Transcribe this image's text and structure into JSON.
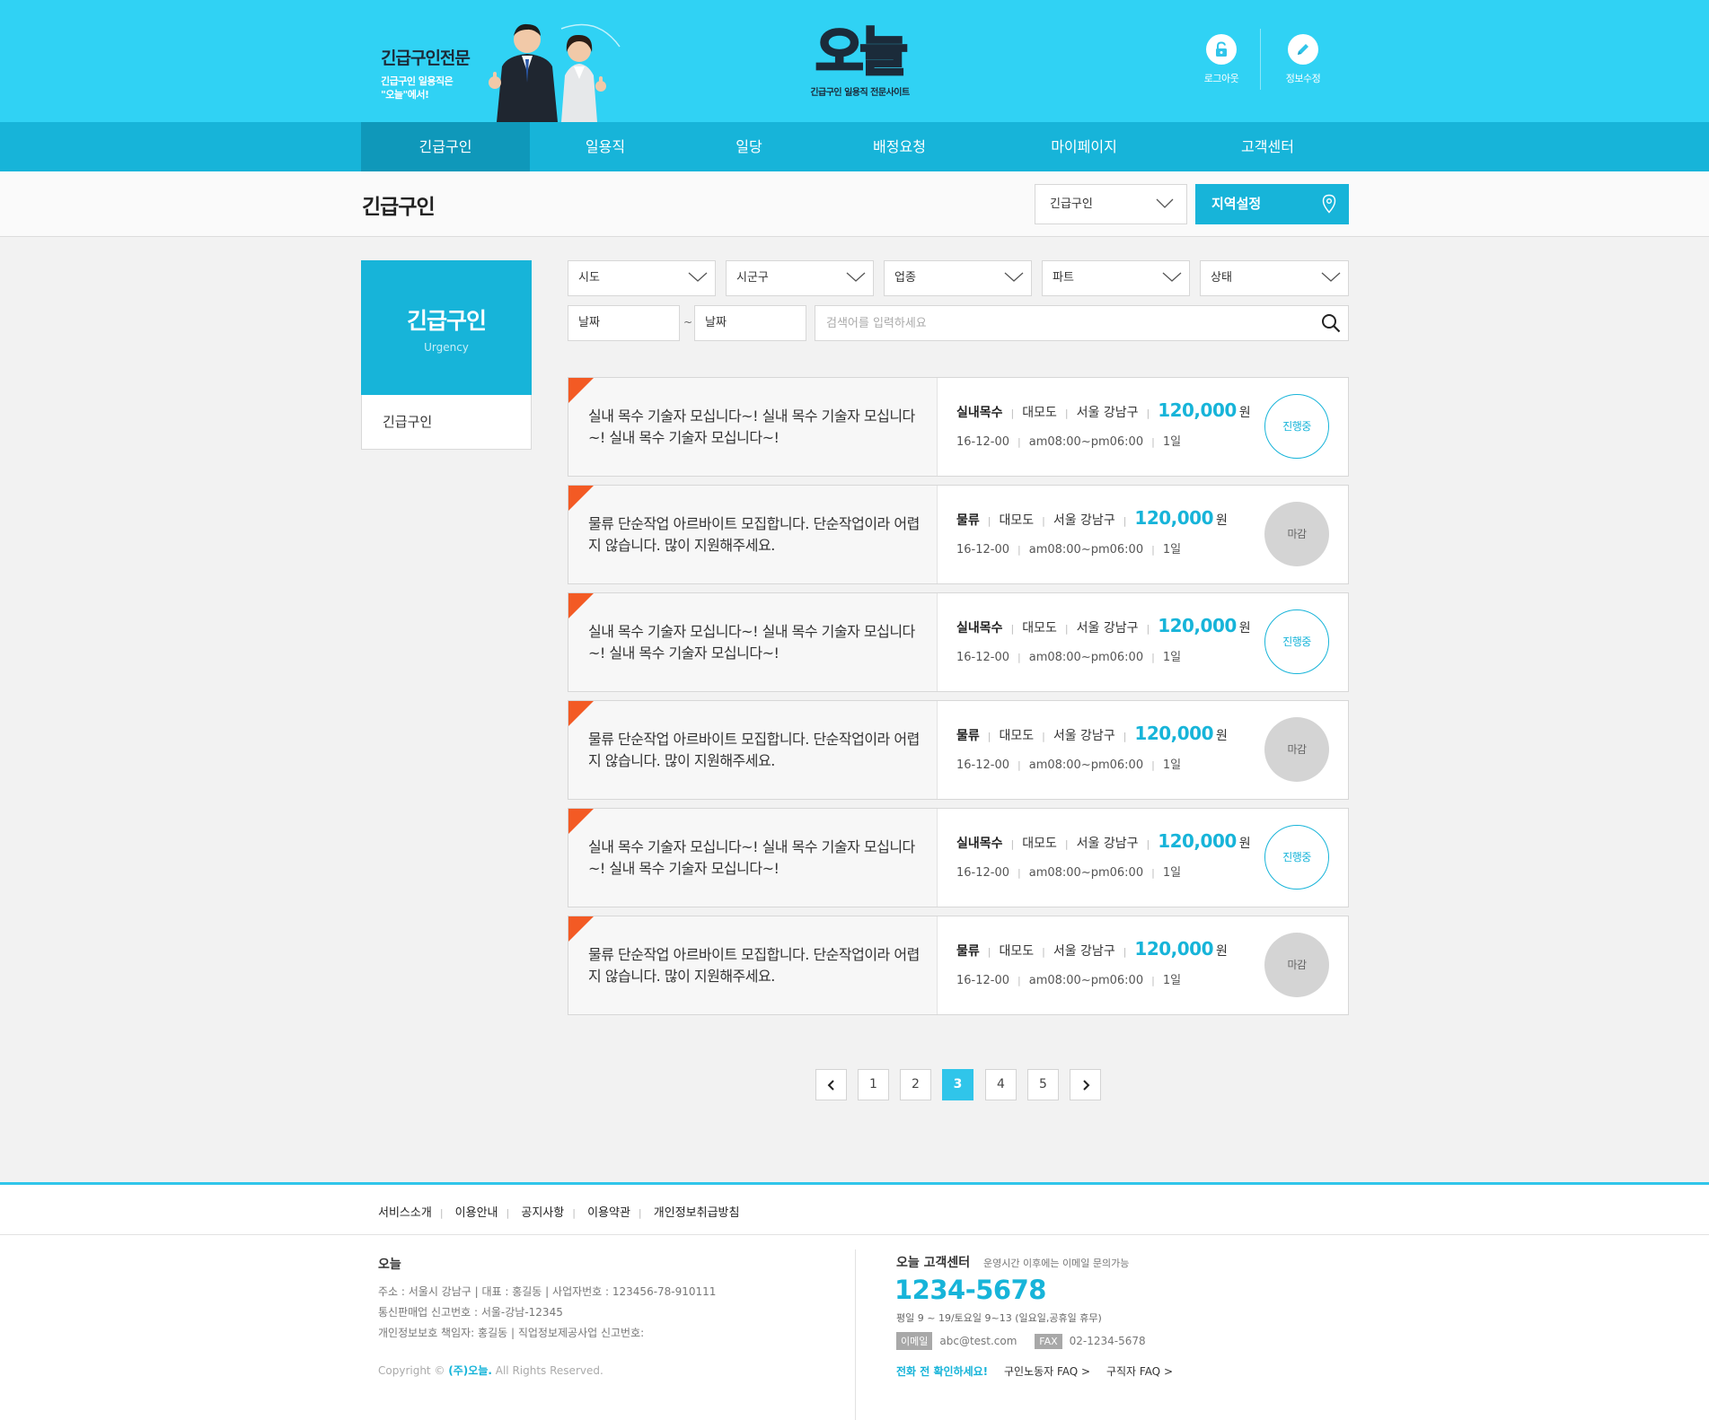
{
  "header": {
    "promo_title": "긴급구인전문",
    "promo_line1": "긴급구인 일용직은",
    "promo_line2": "\"오늘\"에서!",
    "logo_text": "오늘",
    "logo_tagline": "긴급구인 일용직 전문사이트",
    "logout_label": "로그아웃",
    "edit_info_label": "정보수정"
  },
  "nav": {
    "items": [
      "긴급구인",
      "일용직",
      "일당",
      "배정요청",
      "마이페이지",
      "고객센터"
    ],
    "active": "긴급구인"
  },
  "titlebar": {
    "title": "긴급구인",
    "category_select": "긴급구인",
    "region_button": "지역설정"
  },
  "sidebar": {
    "title": "긴급구인",
    "subtitle": "Urgency",
    "menu_item": "긴급구인"
  },
  "filters": {
    "sido": "시도",
    "sigungu": "시군구",
    "industry": "업종",
    "part": "파트",
    "status": "상태",
    "date_from": "날짜",
    "tilde": "~",
    "date_to": "날짜",
    "search_placeholder": "검색어를 입력하세요"
  },
  "listings": [
    {
      "title": "실내 목수 기술자 모십니다~! 실내 목수 기술자 모십니다~! 실내 목수 기술자 모십니다~!",
      "category": "실내목수",
      "type": "대모도",
      "location": "서울 강남구",
      "price": "120,000",
      "unit": "원",
      "date": "16-12-00",
      "time": "am08:00~pm06:00",
      "duration": "1일",
      "status": "진행중",
      "status_color": "#17b4d9"
    },
    {
      "title": "물류 단순작업 아르바이트 모집합니다. 단순작업이라 어렵지 않습니다. 많이 지원해주세요.",
      "category": "물류",
      "type": "대모도",
      "location": "서울 강남구",
      "price": "120,000",
      "unit": "원",
      "date": "16-12-00",
      "time": "am08:00~pm06:00",
      "duration": "1일",
      "status": "마감",
      "status_color": "#d4d4d4"
    },
    {
      "title": "실내 목수 기술자 모십니다~! 실내 목수 기술자 모십니다~! 실내 목수 기술자 모십니다~!",
      "category": "실내목수",
      "type": "대모도",
      "location": "서울 강남구",
      "price": "120,000",
      "unit": "원",
      "date": "16-12-00",
      "time": "am08:00~pm06:00",
      "duration": "1일",
      "status": "진행중",
      "status_color": "#17b4d9"
    },
    {
      "title": "물류 단순작업 아르바이트 모집합니다. 단순작업이라 어렵지 않습니다. 많이 지원해주세요.",
      "category": "물류",
      "type": "대모도",
      "location": "서울 강남구",
      "price": "120,000",
      "unit": "원",
      "date": "16-12-00",
      "time": "am08:00~pm06:00",
      "duration": "1일",
      "status": "마감",
      "status_color": "#d4d4d4"
    },
    {
      "title": "실내 목수 기술자 모십니다~! 실내 목수 기술자 모십니다~! 실내 목수 기술자 모십니다~!",
      "category": "실내목수",
      "type": "대모도",
      "location": "서울 강남구",
      "price": "120,000",
      "unit": "원",
      "date": "16-12-00",
      "time": "am08:00~pm06:00",
      "duration": "1일",
      "status": "진행중",
      "status_color": "#17b4d9"
    },
    {
      "title": "물류 단순작업 아르바이트 모집합니다. 단순작업이라 어렵지 않습니다. 많이 지원해주세요.",
      "category": "물류",
      "type": "대모도",
      "location": "서울 강남구",
      "price": "120,000",
      "unit": "원",
      "date": "16-12-00",
      "time": "am08:00~pm06:00",
      "duration": "1일",
      "status": "마감",
      "status_color": "#d4d4d4"
    }
  ],
  "pagination": {
    "pages": [
      "1",
      "2",
      "3",
      "4",
      "5"
    ],
    "current": "3"
  },
  "footer": {
    "links": [
      "서비스소개",
      "이용안내",
      "공지사항",
      "이용약관",
      "개인정보취급방침"
    ],
    "company_name": "오늘",
    "address_line": "주소 : 서울시 강남구  |  대표 : 홍길동  |  사업자번호 : 123456-78-910111",
    "mail_order_line": "통신판매업 신고번호 : 서울-강남-12345",
    "privacy_line": "개인정보보호 책임자: 홍길동 | 직업정보제공사업 신고번호:",
    "copyright_prefix": "Copyright ©",
    "copyright_company": "(주)오늘.",
    "copyright_suffix": "All Rights Reserved.",
    "cs_title": "오늘 고객센터",
    "cs_note": "운영시간 이후에는 이메일 문의가능",
    "cs_phone": "1234-5678",
    "cs_hours": "평일 9 ~ 19/토요일 9~13 (일요일,공휴일 휴무)",
    "email_tag": "이메일",
    "email": "abc@test.com",
    "fax_tag": "FAX",
    "fax": "02-1234-5678",
    "confirm_text": "전화 전 확인하세요!",
    "faq_seeker": "구인노동자 FAQ >",
    "faq_employer": "구직자 FAQ >"
  }
}
